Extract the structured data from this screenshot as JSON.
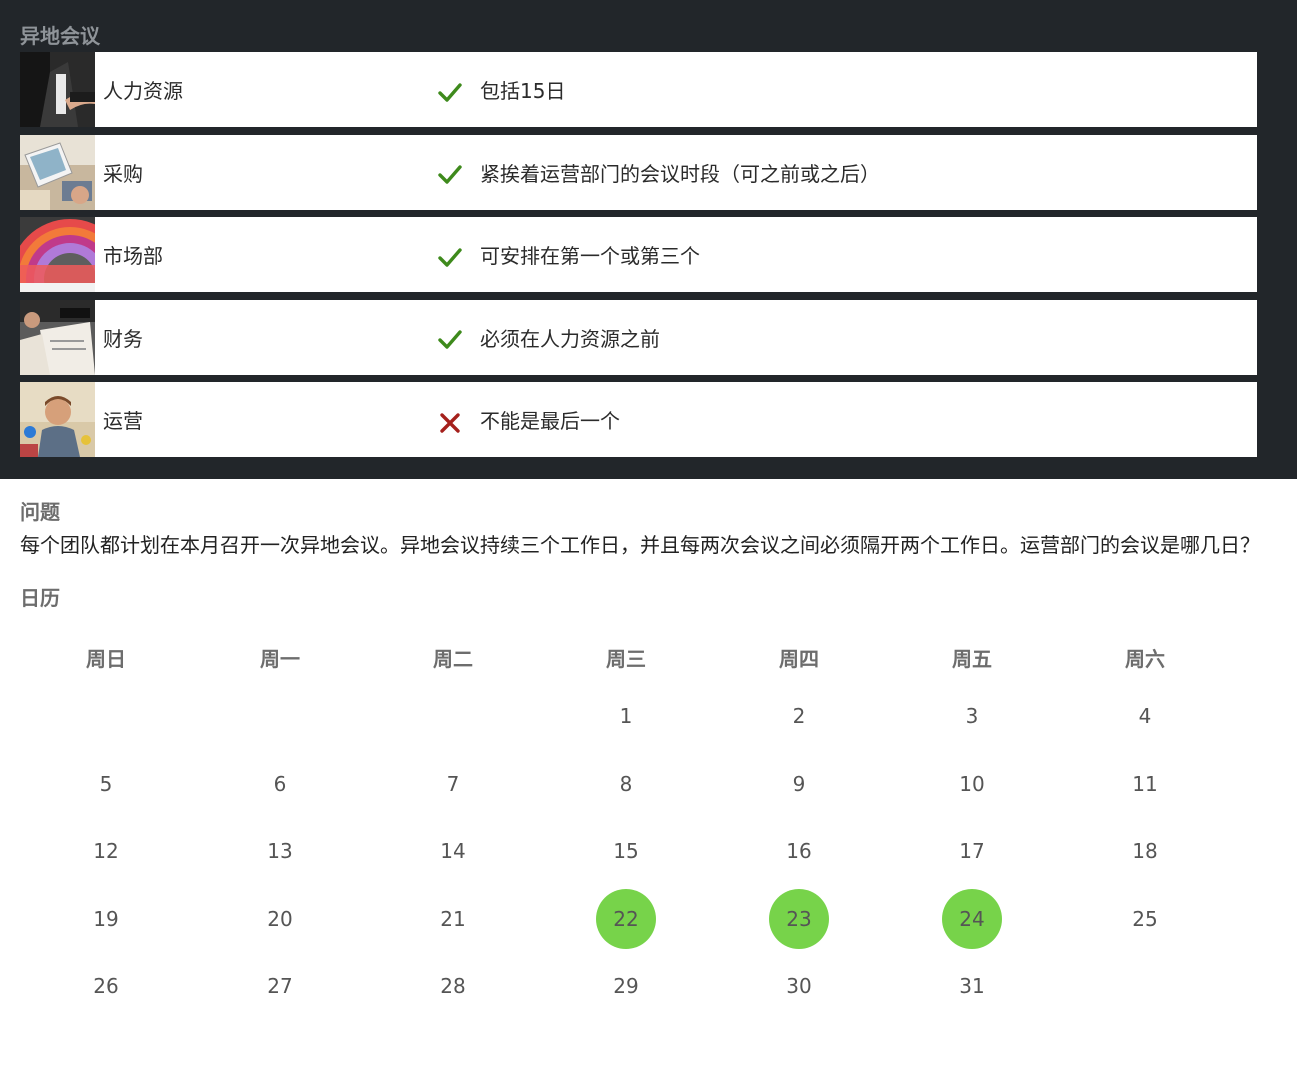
{
  "section_title": "异地会议",
  "teams": [
    {
      "name": "人力资源",
      "status": "check",
      "note": "包括15日",
      "image": "handshake-photo"
    },
    {
      "name": "采购",
      "status": "check",
      "note": "紧挨着运营部门的会议时段（可之前或之后）",
      "image": "laptop-desk-photo"
    },
    {
      "name": "市场部",
      "status": "check",
      "note": "可安排在第一个或第三个",
      "image": "color-wheel-photo"
    },
    {
      "name": "财务",
      "status": "check",
      "note": "必须在人力资源之前",
      "image": "finance-papers-photo"
    },
    {
      "name": "运营",
      "status": "cross",
      "note": "不能是最后一个",
      "image": "man-at-desk-photo"
    }
  ],
  "colors": {
    "check": "#3e8a1c",
    "cross": "#a5201c",
    "highlight": "#77d34a",
    "dark_bg": "#22262a"
  },
  "question": {
    "title": "问题",
    "text": "每个团队都计划在本月召开一次异地会议。异地会议持续三个工作日，并且每两次会议之间必须隔开两个工作日。运营部门的会议是哪几日？"
  },
  "calendar": {
    "title": "日历",
    "weekdays": [
      "周日",
      "周一",
      "周二",
      "周三",
      "周四",
      "周五",
      "周六"
    ],
    "weeks": [
      [
        "",
        "",
        "",
        "1",
        "2",
        "3",
        "4"
      ],
      [
        "5",
        "6",
        "7",
        "8",
        "9",
        "10",
        "11"
      ],
      [
        "12",
        "13",
        "14",
        "15",
        "16",
        "17",
        "18"
      ],
      [
        "19",
        "20",
        "21",
        "22",
        "23",
        "24",
        "25"
      ],
      [
        "26",
        "27",
        "28",
        "29",
        "30",
        "31",
        ""
      ]
    ],
    "selected": [
      "22",
      "23",
      "24"
    ]
  }
}
